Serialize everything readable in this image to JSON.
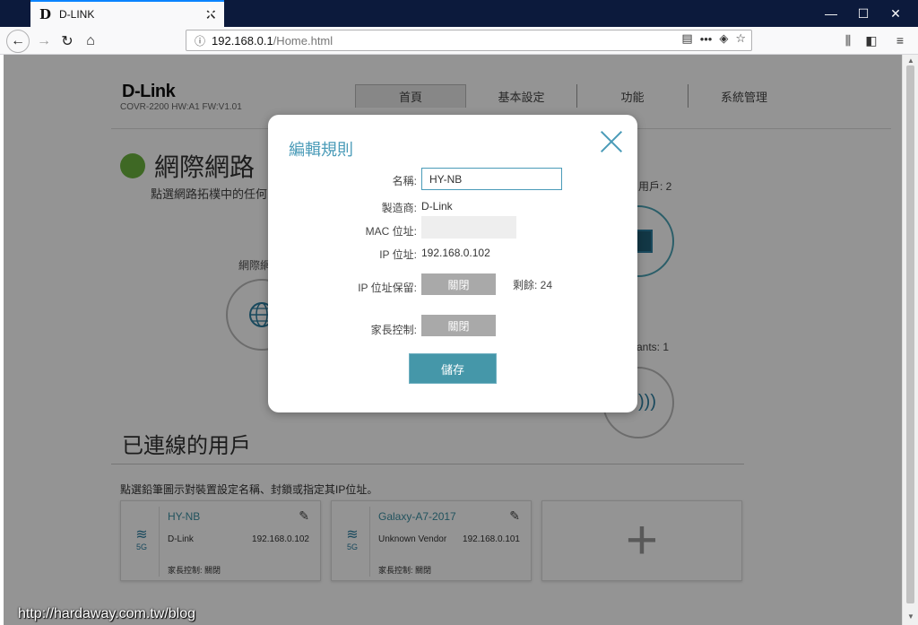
{
  "browser": {
    "tab_title": "D-LINK",
    "tab_favicon": "D",
    "url_host": "192.168.0.1",
    "url_path": "/Home.html"
  },
  "page": {
    "brand": "D-Link",
    "model": "COVR-2200 HW:A1 FW:V1.01",
    "nav": [
      "首頁",
      "基本設定",
      "功能",
      "系統管理"
    ],
    "network_title": "網際網路",
    "network_sub": "點選網路拓樸中的任何",
    "internet_label": "網際網",
    "users_label": "用戶: 2",
    "clients_label": "ants: 1",
    "connected_title": "已連線的用戶",
    "connected_sub": "點選鉛筆圖示對裝置設定名稱、封鎖或指定其IP位址。",
    "cards": [
      {
        "name": "HY-NB",
        "vendor": "D-Link",
        "ip": "192.168.0.102",
        "parental": "家長控制: 關閉"
      },
      {
        "name": "Galaxy-A7-2017",
        "vendor": "Unknown Vendor",
        "ip": "192.168.0.101",
        "parental": "家長控制: 關閉"
      }
    ]
  },
  "modal": {
    "title": "編輯規則",
    "name_label": "名稱:",
    "name_value": "HY-NB",
    "vendor_label": "製造商:",
    "vendor_value": "D-Link",
    "mac_label": "MAC 位址:",
    "ip_label": "IP 位址:",
    "ip_value": "192.168.0.102",
    "reserve_label": "IP 位址保留:",
    "reserve_toggle": "關閉",
    "remaining": "剩餘: 24",
    "parental_label": "家長控制:",
    "parental_toggle": "關閉",
    "save_label": "儲存"
  },
  "watermark": "http://hardaway.com.tw/blog",
  "colors": {
    "accent": "#4597a9",
    "status_green": "#6cb33f",
    "tab_strip": "#0c1a3c"
  }
}
